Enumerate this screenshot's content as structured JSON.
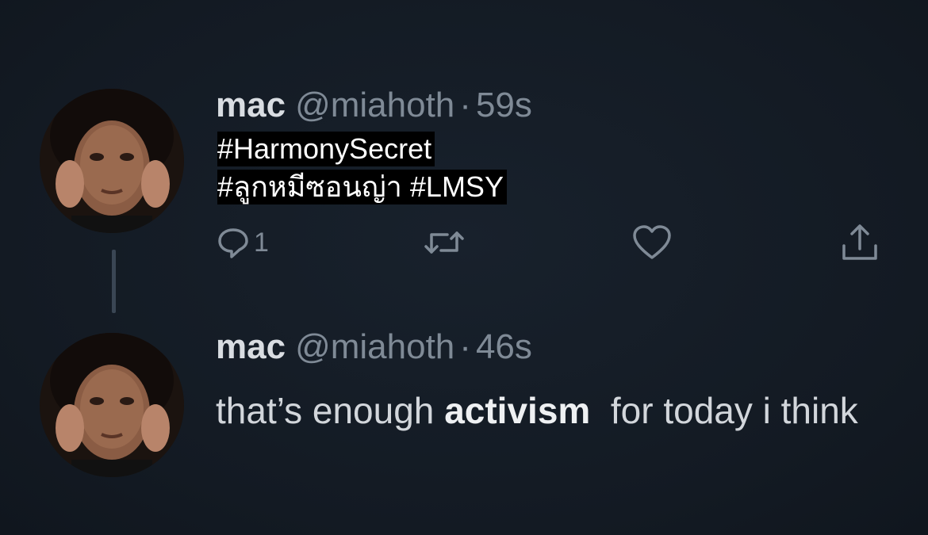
{
  "tweets": [
    {
      "name": "mac",
      "handle": "@miahoth",
      "separator": "·",
      "time": "59s",
      "hashtag_line_1": "#HarmonySecret",
      "hashtag_line_2": "#ลูกหมีซอนญ่า #LMSY",
      "reply_count": "1",
      "icons": [
        "reply-icon",
        "retweet-icon",
        "like-icon",
        "share-icon"
      ]
    },
    {
      "name": "mac",
      "handle": "@miahoth",
      "separator": "·",
      "time": "46s",
      "text_before": "that’s enough ",
      "text_bold": "activism",
      "text_after": "  for today i think"
    }
  ],
  "colors": {
    "background": "#141c26",
    "muted": "#7f8a96",
    "name": "#d9dde2",
    "overlay_text": "#ffffff"
  }
}
